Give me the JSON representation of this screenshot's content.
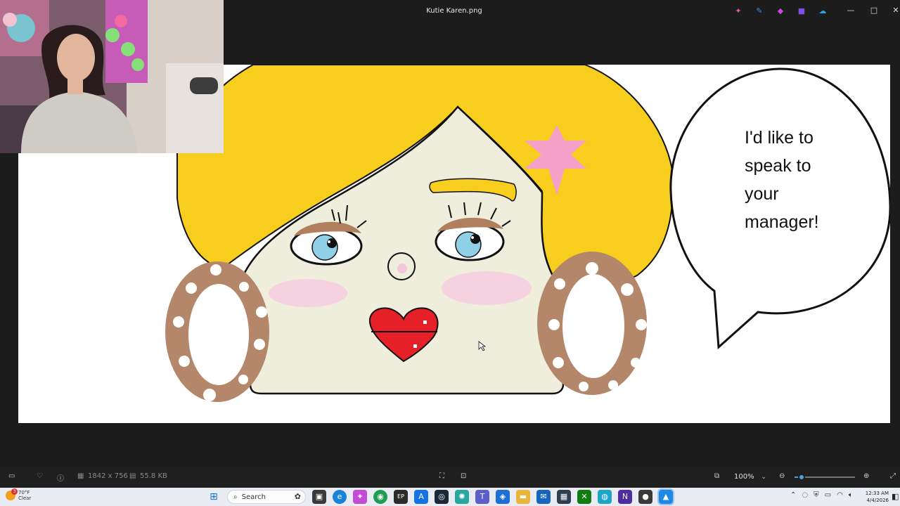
{
  "window": {
    "title": "Kutie Karen.png",
    "minimize": "—",
    "maximize": "□",
    "close": "✕"
  },
  "title_icons": [
    {
      "name": "copilot-icon",
      "glyph": "✦",
      "color": "#e05aa6"
    },
    {
      "name": "edit-icon",
      "glyph": "✎",
      "color": "#3a8fe0"
    },
    {
      "name": "designer-icon",
      "glyph": "◆",
      "color": "#c34bd6"
    },
    {
      "name": "clipchamp-icon",
      "glyph": "■",
      "color": "#7b4fe0"
    },
    {
      "name": "onedrive-icon",
      "glyph": "☁",
      "color": "#2f9fe8"
    }
  ],
  "image": {
    "speech_bubble_lines": [
      "I'd like to",
      "speak to",
      "your",
      "manager!"
    ]
  },
  "viewer_bar": {
    "dimensions": "1842 x 756",
    "file_size": "55.8 KB",
    "zoom": "100%",
    "zoom_fraction": 0.12
  },
  "taskbar": {
    "weather_temp": "70°F",
    "weather_condition": "Clear",
    "weather_badge": "3",
    "search_placeholder": "Search",
    "time": "12:33 AM",
    "date": "4/4/2026"
  }
}
